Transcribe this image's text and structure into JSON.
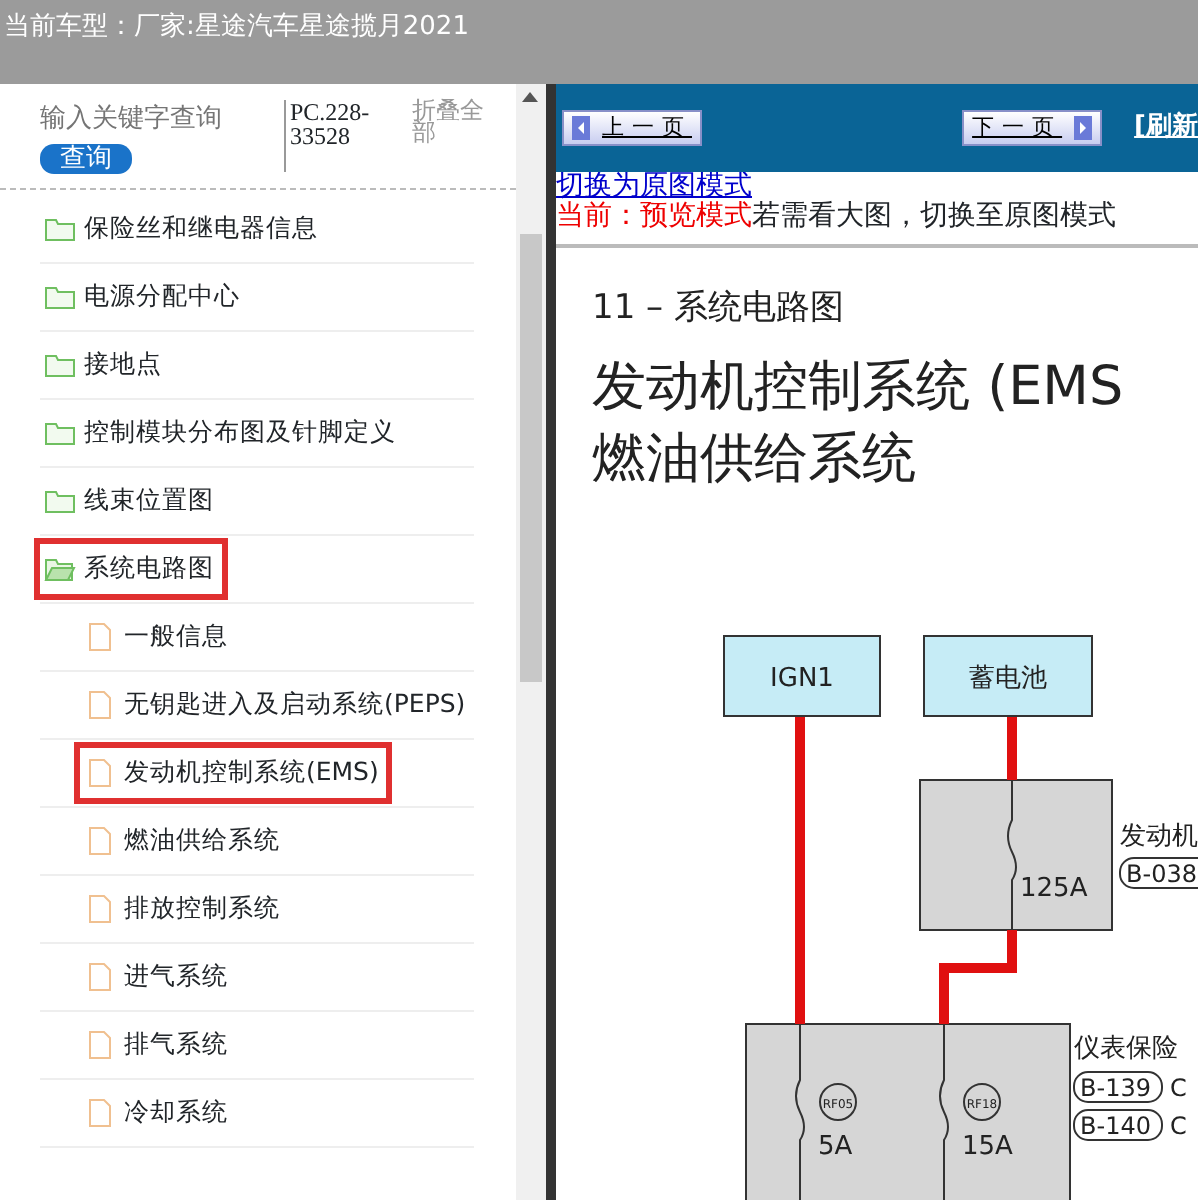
{
  "header": {
    "label": "当前车型：",
    "value": "厂家:星途汽车星途揽月2021"
  },
  "search": {
    "placeholder": "输入关键字查询",
    "button": "查询"
  },
  "doc_code": "PC.228-33528",
  "collapse_all": "折叠全部",
  "tree": [
    {
      "label": "保险丝和继电器信息",
      "kind": "folder",
      "expanded": false,
      "highlighted": false
    },
    {
      "label": "电源分配中心",
      "kind": "folder",
      "expanded": false,
      "highlighted": false
    },
    {
      "label": "接地点",
      "kind": "folder",
      "expanded": false,
      "highlighted": false
    },
    {
      "label": "控制模块分布图及针脚定义",
      "kind": "folder",
      "expanded": false,
      "highlighted": false
    },
    {
      "label": "线束位置图",
      "kind": "folder",
      "expanded": false,
      "highlighted": false
    },
    {
      "label": "系统电路图",
      "kind": "folder",
      "expanded": true,
      "highlighted": true,
      "children": [
        {
          "label": "一般信息",
          "kind": "file",
          "highlighted": false
        },
        {
          "label": "无钥匙进入及启动系统(PEPS)",
          "kind": "file",
          "highlighted": false
        },
        {
          "label": "发动机控制系统(EMS)",
          "kind": "file",
          "highlighted": true
        },
        {
          "label": "燃油供给系统",
          "kind": "file",
          "highlighted": false
        },
        {
          "label": "排放控制系统",
          "kind": "file",
          "highlighted": false
        },
        {
          "label": "进气系统",
          "kind": "file",
          "highlighted": false
        },
        {
          "label": "排气系统",
          "kind": "file",
          "highlighted": false
        },
        {
          "label": "冷却系统",
          "kind": "file",
          "highlighted": false
        }
      ]
    }
  ],
  "nav": {
    "prev": "上一页",
    "next": "下一页",
    "refresh": "[刷新"
  },
  "mode": {
    "switch_link": "切换为原图模式",
    "current": "当前：预览模式",
    "hint": "若需看大图，切换至原图模式"
  },
  "document": {
    "section": "11 – 系统电路图",
    "title_lines": [
      "发动机控制系统 (EMS",
      "燃油供给系统"
    ],
    "diagram": {
      "sources": [
        "IGN1",
        "蓄电池"
      ],
      "main_fuse": "125A",
      "module_label": "发动机",
      "module_connector": "B-038",
      "fuse_box_label": "仪表保险",
      "fuse_box_connectors": [
        {
          "id": "B-139",
          "pin": "C"
        },
        {
          "id": "B-140",
          "pin": "C"
        }
      ],
      "fuses": [
        {
          "id": "RF05",
          "rating": "5A"
        },
        {
          "id": "RF18",
          "rating": "15A"
        }
      ]
    }
  }
}
